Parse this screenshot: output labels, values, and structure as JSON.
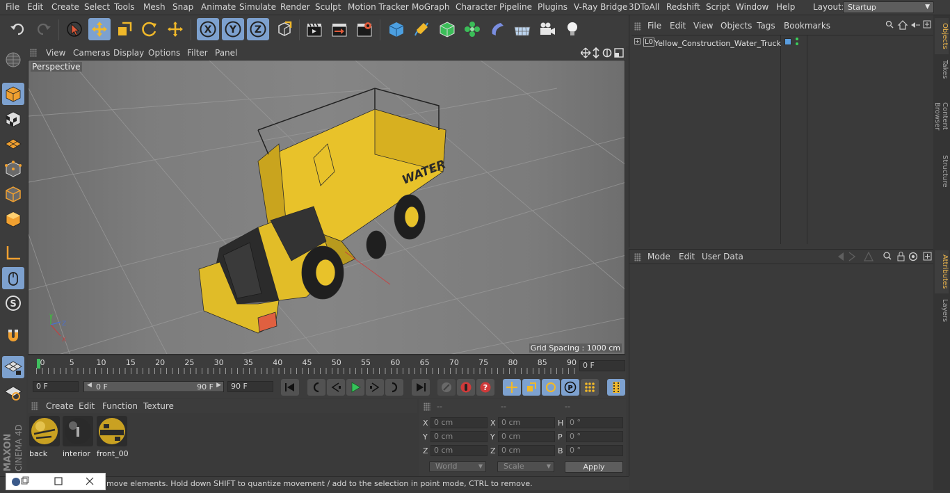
{
  "menubar": {
    "items": [
      "File",
      "Edit",
      "Create",
      "Select",
      "Tools",
      "Mesh",
      "Snap",
      "Animate",
      "Simulate",
      "Render",
      "Sculpt",
      "Motion Tracker",
      "MoGraph",
      "Character",
      "Pipeline",
      "Plugins",
      "V-Ray Bridge",
      "3DToAll",
      "Redshift",
      "Script",
      "Window",
      "Help"
    ],
    "layout_label": "Layout:",
    "layout_value": "Startup"
  },
  "viewport": {
    "menu": [
      "View",
      "Cameras",
      "Display",
      "Options",
      "Filter",
      "Panel"
    ],
    "camera_label": "Perspective",
    "grid_spacing": "Grid Spacing : 1000 cm",
    "model_text": "WATER"
  },
  "timeline": {
    "ticks": [
      "0",
      "5",
      "10",
      "15",
      "20",
      "25",
      "30",
      "35",
      "40",
      "45",
      "50",
      "55",
      "60",
      "65",
      "70",
      "75",
      "80",
      "85",
      "90"
    ],
    "current_frame": "0 F"
  },
  "transport": {
    "start_field": "0 F",
    "range_start": "0 F",
    "range_end": "90 F",
    "end_field": "90 F"
  },
  "materials": {
    "menu": [
      "Create",
      "Edit",
      "Function",
      "Texture"
    ],
    "items": [
      "back",
      "interior",
      "front_00"
    ]
  },
  "coordinates": {
    "headers": [
      "--",
      "--",
      "--"
    ],
    "rows": [
      {
        "l1": "X",
        "v1": "0 cm",
        "l2": "X",
        "v2": "0 cm",
        "l3": "H",
        "v3": "0 °"
      },
      {
        "l1": "Y",
        "v1": "0 cm",
        "l2": "Y",
        "v2": "0 cm",
        "l3": "P",
        "v3": "0 °"
      },
      {
        "l1": "Z",
        "v1": "0 cm",
        "l2": "Z",
        "v2": "0 cm",
        "l3": "B",
        "v3": "0 °"
      }
    ],
    "world": "World",
    "scale": "Scale",
    "apply": "Apply"
  },
  "status": {
    "text": "move elements. Hold down SHIFT to quantize movement / add to the selection in point mode, CTRL to remove."
  },
  "objects": {
    "menu": [
      "File",
      "Edit",
      "View",
      "Objects",
      "Tags",
      "Bookmarks"
    ],
    "object_name": "Yellow_Construction_Water_Truck",
    "layer_badge": "L0"
  },
  "attributes": {
    "menu": [
      "Mode",
      "Edit",
      "User Data"
    ]
  },
  "right_tabs": [
    "Objects",
    "Takes",
    "Content Browser",
    "Structure",
    "Attributes",
    "Layers"
  ],
  "brand": {
    "maxon": "MAXON",
    "product": "CINEMA 4D"
  },
  "colors": {
    "accent": "#7da1cf",
    "truck": "#e8c22a",
    "tab_active": "#f0b84c"
  }
}
